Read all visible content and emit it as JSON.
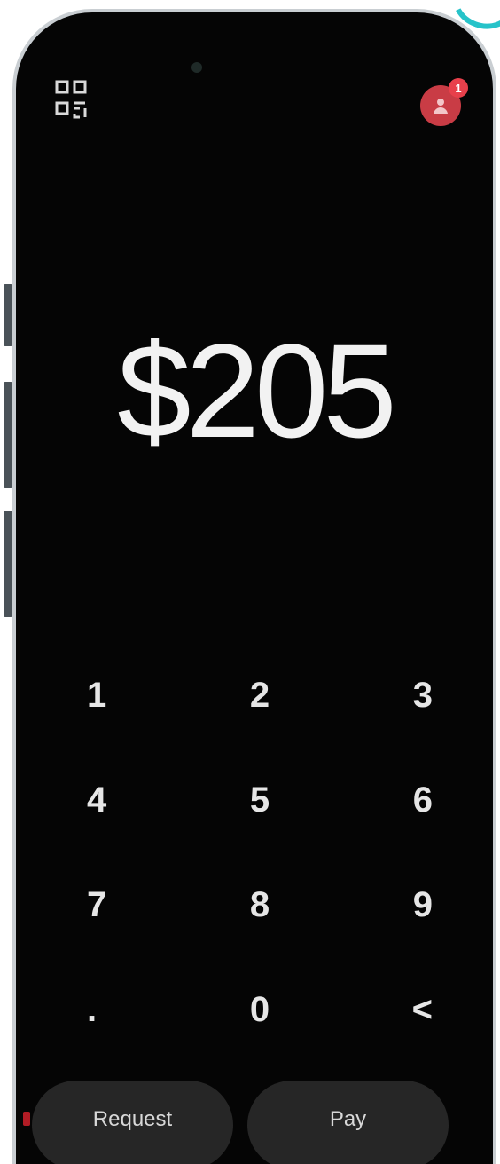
{
  "amount_display": "$205",
  "keypad": {
    "keys": [
      "1",
      "2",
      "3",
      "4",
      "5",
      "6",
      "7",
      "8",
      "9",
      ".",
      "0",
      "<"
    ]
  },
  "actions": {
    "request_label": "Request",
    "pay_label": "Pay"
  },
  "header": {
    "scan_icon": "qr-scan-icon",
    "profile_icon": "profile-avatar-icon",
    "notification_badge": "1"
  },
  "colors": {
    "screen_bg": "#050505",
    "profile_accent": "#c93c45",
    "button_bg": "#262626",
    "text": "#f2f2f2"
  }
}
